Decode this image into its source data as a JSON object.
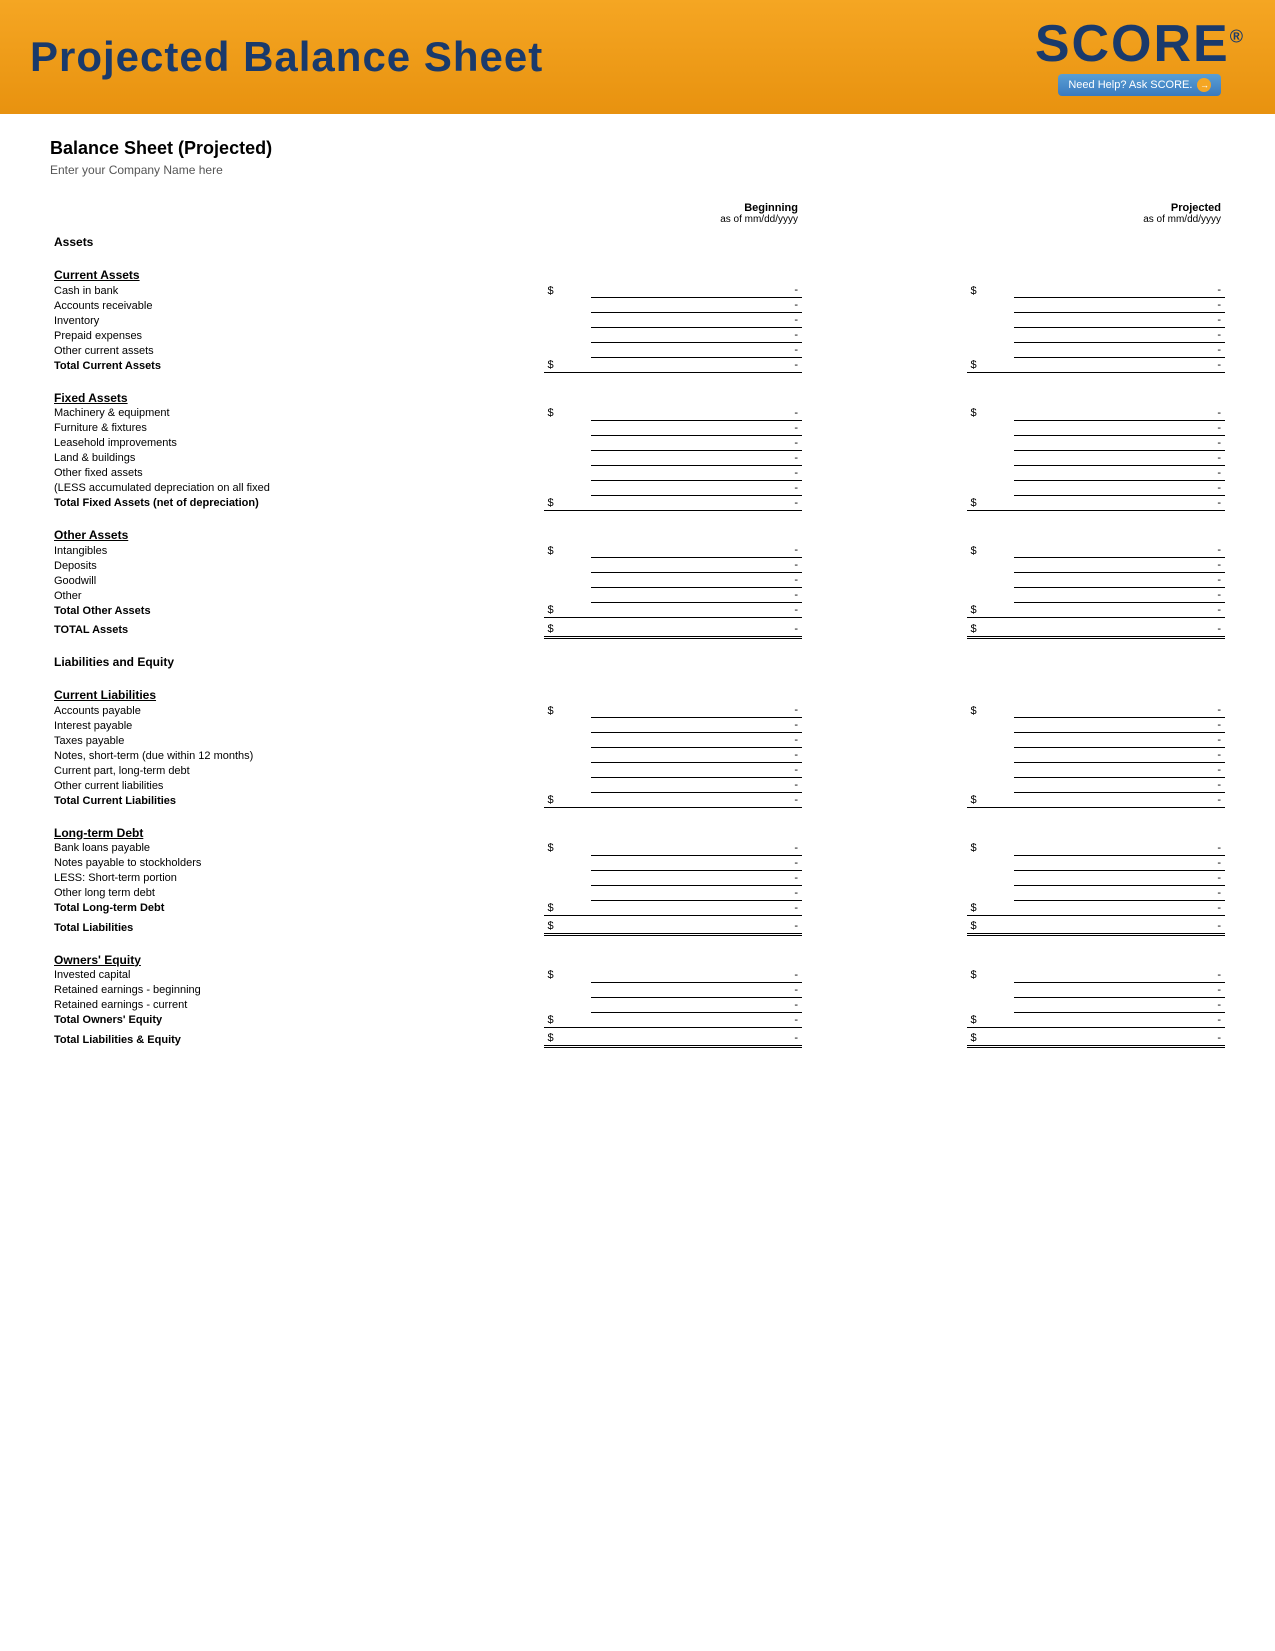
{
  "header": {
    "title": "Projected Balance Sheet",
    "score_text": "SCORE",
    "score_reg": "®",
    "score_help": "Need Help? Ask SCORE.",
    "score_arrow": "→"
  },
  "page_title": "Balance Sheet (Projected)",
  "company_name": "Enter your Company Name here",
  "columns": {
    "beginning_label": "Beginning",
    "beginning_sub": "as of mm/dd/yyyy",
    "projected_label": "Projected",
    "projected_sub": "as of mm/dd/yyyy"
  },
  "sections": {
    "assets_label": "Assets",
    "current_assets": {
      "header": "Current Assets",
      "rows": [
        {
          "label": "Cash in bank",
          "has_dollar": true
        },
        {
          "label": "Accounts receivable",
          "has_dollar": false
        },
        {
          "label": "Inventory",
          "has_dollar": false
        },
        {
          "label": "Prepaid expenses",
          "has_dollar": false
        },
        {
          "label": "Other current assets",
          "has_dollar": false
        }
      ],
      "total_label": "Total Current Assets"
    },
    "fixed_assets": {
      "header": "Fixed Assets",
      "rows": [
        {
          "label": "Machinery & equipment",
          "has_dollar": true
        },
        {
          "label": "Furniture & fixtures",
          "has_dollar": false
        },
        {
          "label": "Leasehold improvements",
          "has_dollar": false
        },
        {
          "label": "Land & buildings",
          "has_dollar": false
        },
        {
          "label": "Other fixed assets",
          "has_dollar": false
        },
        {
          "label": "(LESS accumulated depreciation on all fixed",
          "has_dollar": false
        }
      ],
      "total_label": "Total Fixed Assets (net of depreciation)"
    },
    "other_assets": {
      "header": "Other Assets",
      "rows": [
        {
          "label": "Intangibles",
          "has_dollar": true
        },
        {
          "label": "Deposits",
          "has_dollar": false
        },
        {
          "label": "Goodwill",
          "has_dollar": false
        },
        {
          "label": "Other",
          "has_dollar": false
        }
      ],
      "total_label": "Total Other Assets"
    },
    "total_assets_label": "TOTAL Assets",
    "liabilities_equity_label": "Liabilities and Equity",
    "current_liabilities": {
      "header": "Current Liabilities",
      "rows": [
        {
          "label": "Accounts payable",
          "has_dollar": true
        },
        {
          "label": "Interest payable",
          "has_dollar": false
        },
        {
          "label": "Taxes payable",
          "has_dollar": false
        },
        {
          "label": "Notes, short-term (due within 12 months)",
          "has_dollar": false
        },
        {
          "label": "Current part, long-term debt",
          "has_dollar": false
        },
        {
          "label": "Other current liabilities",
          "has_dollar": false
        }
      ],
      "total_label": "Total Current Liabilities"
    },
    "long_term_debt": {
      "header": "Long-term Debt",
      "rows": [
        {
          "label": "Bank loans payable",
          "has_dollar": true
        },
        {
          "label": "Notes payable to stockholders",
          "has_dollar": false
        },
        {
          "label": "LESS: Short-term portion",
          "has_dollar": false
        },
        {
          "label": "Other long term debt",
          "has_dollar": false
        }
      ],
      "total_label": "Total Long-term Debt"
    },
    "total_liabilities_label": "Total Liabilities",
    "owners_equity": {
      "header": "Owners' Equity",
      "rows": [
        {
          "label": "Invested capital",
          "has_dollar": true
        },
        {
          "label": "Retained earnings - beginning",
          "has_dollar": false
        },
        {
          "label": "Retained earnings - current",
          "has_dollar": false
        }
      ],
      "total_label": "Total Owners' Equity"
    },
    "total_liabilities_equity_label": "Total Liabilities & Equity"
  },
  "dash": "-",
  "dollar": "$"
}
